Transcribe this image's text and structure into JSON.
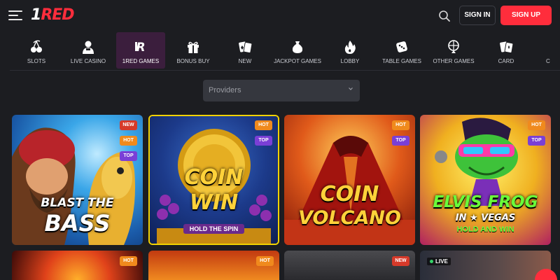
{
  "header": {
    "logo_prefix": "1",
    "logo_text": "RED",
    "signin_label": "SIGN IN",
    "signup_label": "SIGN UP"
  },
  "nav": {
    "items": [
      {
        "label": "SLOTS",
        "icon": "cherries-icon"
      },
      {
        "label": "LIVE CASINO",
        "icon": "dealer-icon"
      },
      {
        "label": "1RED GAMES",
        "icon": "1red-logo-icon",
        "active": true
      },
      {
        "label": "BONUS BUY",
        "icon": "gift-icon"
      },
      {
        "label": "NEW",
        "icon": "cards-icon"
      },
      {
        "label": "JACKPOT GAMES",
        "icon": "money-bag-icon"
      },
      {
        "label": "LOBBY",
        "icon": "fire-icon"
      },
      {
        "label": "TABLE GAMES",
        "icon": "dice-icon"
      },
      {
        "label": "OTHER GAMES",
        "icon": "wheel-icon"
      },
      {
        "label": "CARD",
        "icon": "playing-cards-icon"
      },
      {
        "label": "C",
        "icon": "partial-icon"
      }
    ]
  },
  "providers": {
    "placeholder": "Providers"
  },
  "games": [
    {
      "title_line1": "BLAST THE",
      "title_line2": "BASS",
      "badges": [
        "NEW",
        "HOT",
        "TOP"
      ]
    },
    {
      "title_line1": "COIN",
      "title_line2": "WIN",
      "subtitle": "HOLD THE SPIN",
      "badges": [
        "HOT",
        "TOP"
      ]
    },
    {
      "title_line1": "COIN",
      "title_line2": "VOLCANO",
      "badges": [
        "HOT",
        "TOP"
      ]
    },
    {
      "title_line1": "ELVIS FROG",
      "title_line2": "IN ★ VEGAS",
      "subtitle": "HOLD AND WIN",
      "badges": [
        "HOT",
        "TOP"
      ]
    },
    {
      "badges": [
        "HOT"
      ]
    },
    {
      "badges": [
        "HOT"
      ]
    },
    {
      "badges": [
        "NEW"
      ]
    },
    {
      "live_label": "LIVE",
      "badges": []
    }
  ],
  "colors": {
    "brand_red": "#ff2d3c",
    "background": "#1c1d21",
    "active_nav": "#3b1e3d",
    "badge_new": "#d63a2a",
    "badge_hot": "#f08a1d",
    "badge_top": "#7a3fd6"
  }
}
